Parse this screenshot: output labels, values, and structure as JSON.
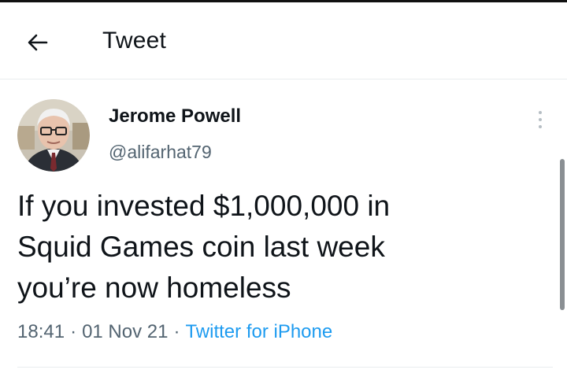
{
  "header": {
    "back_icon": "arrow-left-icon",
    "title": "Tweet"
  },
  "tweet": {
    "author": {
      "display_name": "Jerome Powell",
      "handle": "@alifarhat79",
      "avatar": "profile-photo"
    },
    "more_icon": "vertical-ellipsis-icon",
    "text": "If you invested $1,000,000 in\nSquid Games coin last week\nyou’re now homeless",
    "meta": {
      "time": "18:41",
      "separator": "·",
      "date": "01 Nov 21",
      "source": "Twitter for iPhone"
    }
  },
  "colors": {
    "text": "#0f1419",
    "secondary": "#536471",
    "link": "#1d9bf0",
    "divider": "#e9ecee"
  }
}
